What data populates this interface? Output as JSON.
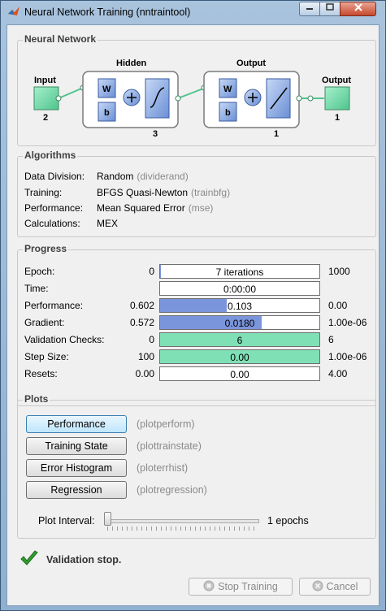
{
  "window": {
    "title": "Neural Network Training (nntraintool)"
  },
  "network": {
    "section_title": "Neural Network",
    "input_label": "Input",
    "input_size": "2",
    "hidden_label": "Hidden",
    "hidden_size": "3",
    "output_layer_label": "Output",
    "output_layer_size": "1",
    "output_label": "Output",
    "output_size": "1",
    "weight_symbol": "W",
    "bias_symbol": "b"
  },
  "algorithms": {
    "section_title": "Algorithms",
    "rows": [
      {
        "label": "Data Division:",
        "value": "Random",
        "func": "(dividerand)"
      },
      {
        "label": "Training:",
        "value": "BFGS Quasi-Newton",
        "func": "(trainbfg)"
      },
      {
        "label": "Performance:",
        "value": "Mean Squared Error",
        "func": "(mse)"
      },
      {
        "label": "Calculations:",
        "value": "MEX",
        "func": ""
      }
    ]
  },
  "progress": {
    "section_title": "Progress",
    "rows": [
      {
        "label": "Epoch:",
        "start": "0",
        "current": "7 iterations",
        "end": "1000",
        "fill": 0.007,
        "color": "#7b95dc"
      },
      {
        "label": "Time:",
        "start": "",
        "current": "0:00:00",
        "end": "",
        "fill": 0,
        "color": "#7b95dc"
      },
      {
        "label": "Performance:",
        "start": "0.602",
        "current": "0.103",
        "end": "0.00",
        "fill": 0.42,
        "color": "#7b95dc"
      },
      {
        "label": "Gradient:",
        "start": "0.572",
        "current": "0.0180",
        "end": "1.00e-06",
        "fill": 0.64,
        "color": "#7b95dc"
      },
      {
        "label": "Validation Checks:",
        "start": "0",
        "current": "6",
        "end": "6",
        "fill": 1.0,
        "color": "#7fe0b6"
      },
      {
        "label": "Step Size:",
        "start": "100",
        "current": "0.00",
        "end": "1.00e-06",
        "fill": 1.0,
        "color": "#7fe0b6"
      },
      {
        "label": "Resets:",
        "start": "0.00",
        "current": "0.00",
        "end": "4.00",
        "fill": 0,
        "color": "#7b95dc"
      }
    ]
  },
  "plots": {
    "section_title": "Plots",
    "buttons": [
      {
        "label": "Performance",
        "func": "(plotperform)"
      },
      {
        "label": "Training State",
        "func": "(plottrainstate)"
      },
      {
        "label": "Error Histogram",
        "func": "(ploterrhist)"
      },
      {
        "label": "Regression",
        "func": "(plotregression)"
      }
    ],
    "interval_label": "Plot Interval:",
    "interval_value": "1 epochs",
    "interval_level": 0
  },
  "status": {
    "text": "Validation stop."
  },
  "footer": {
    "stop_label": "Stop Training",
    "cancel_label": "Cancel"
  },
  "colors": {
    "accent": "#3c7fb1",
    "progress_blue": "#7b95dc",
    "progress_green": "#7fe0b6",
    "node_green": "#6fd6a8",
    "check_green": "#2f9e2f"
  }
}
